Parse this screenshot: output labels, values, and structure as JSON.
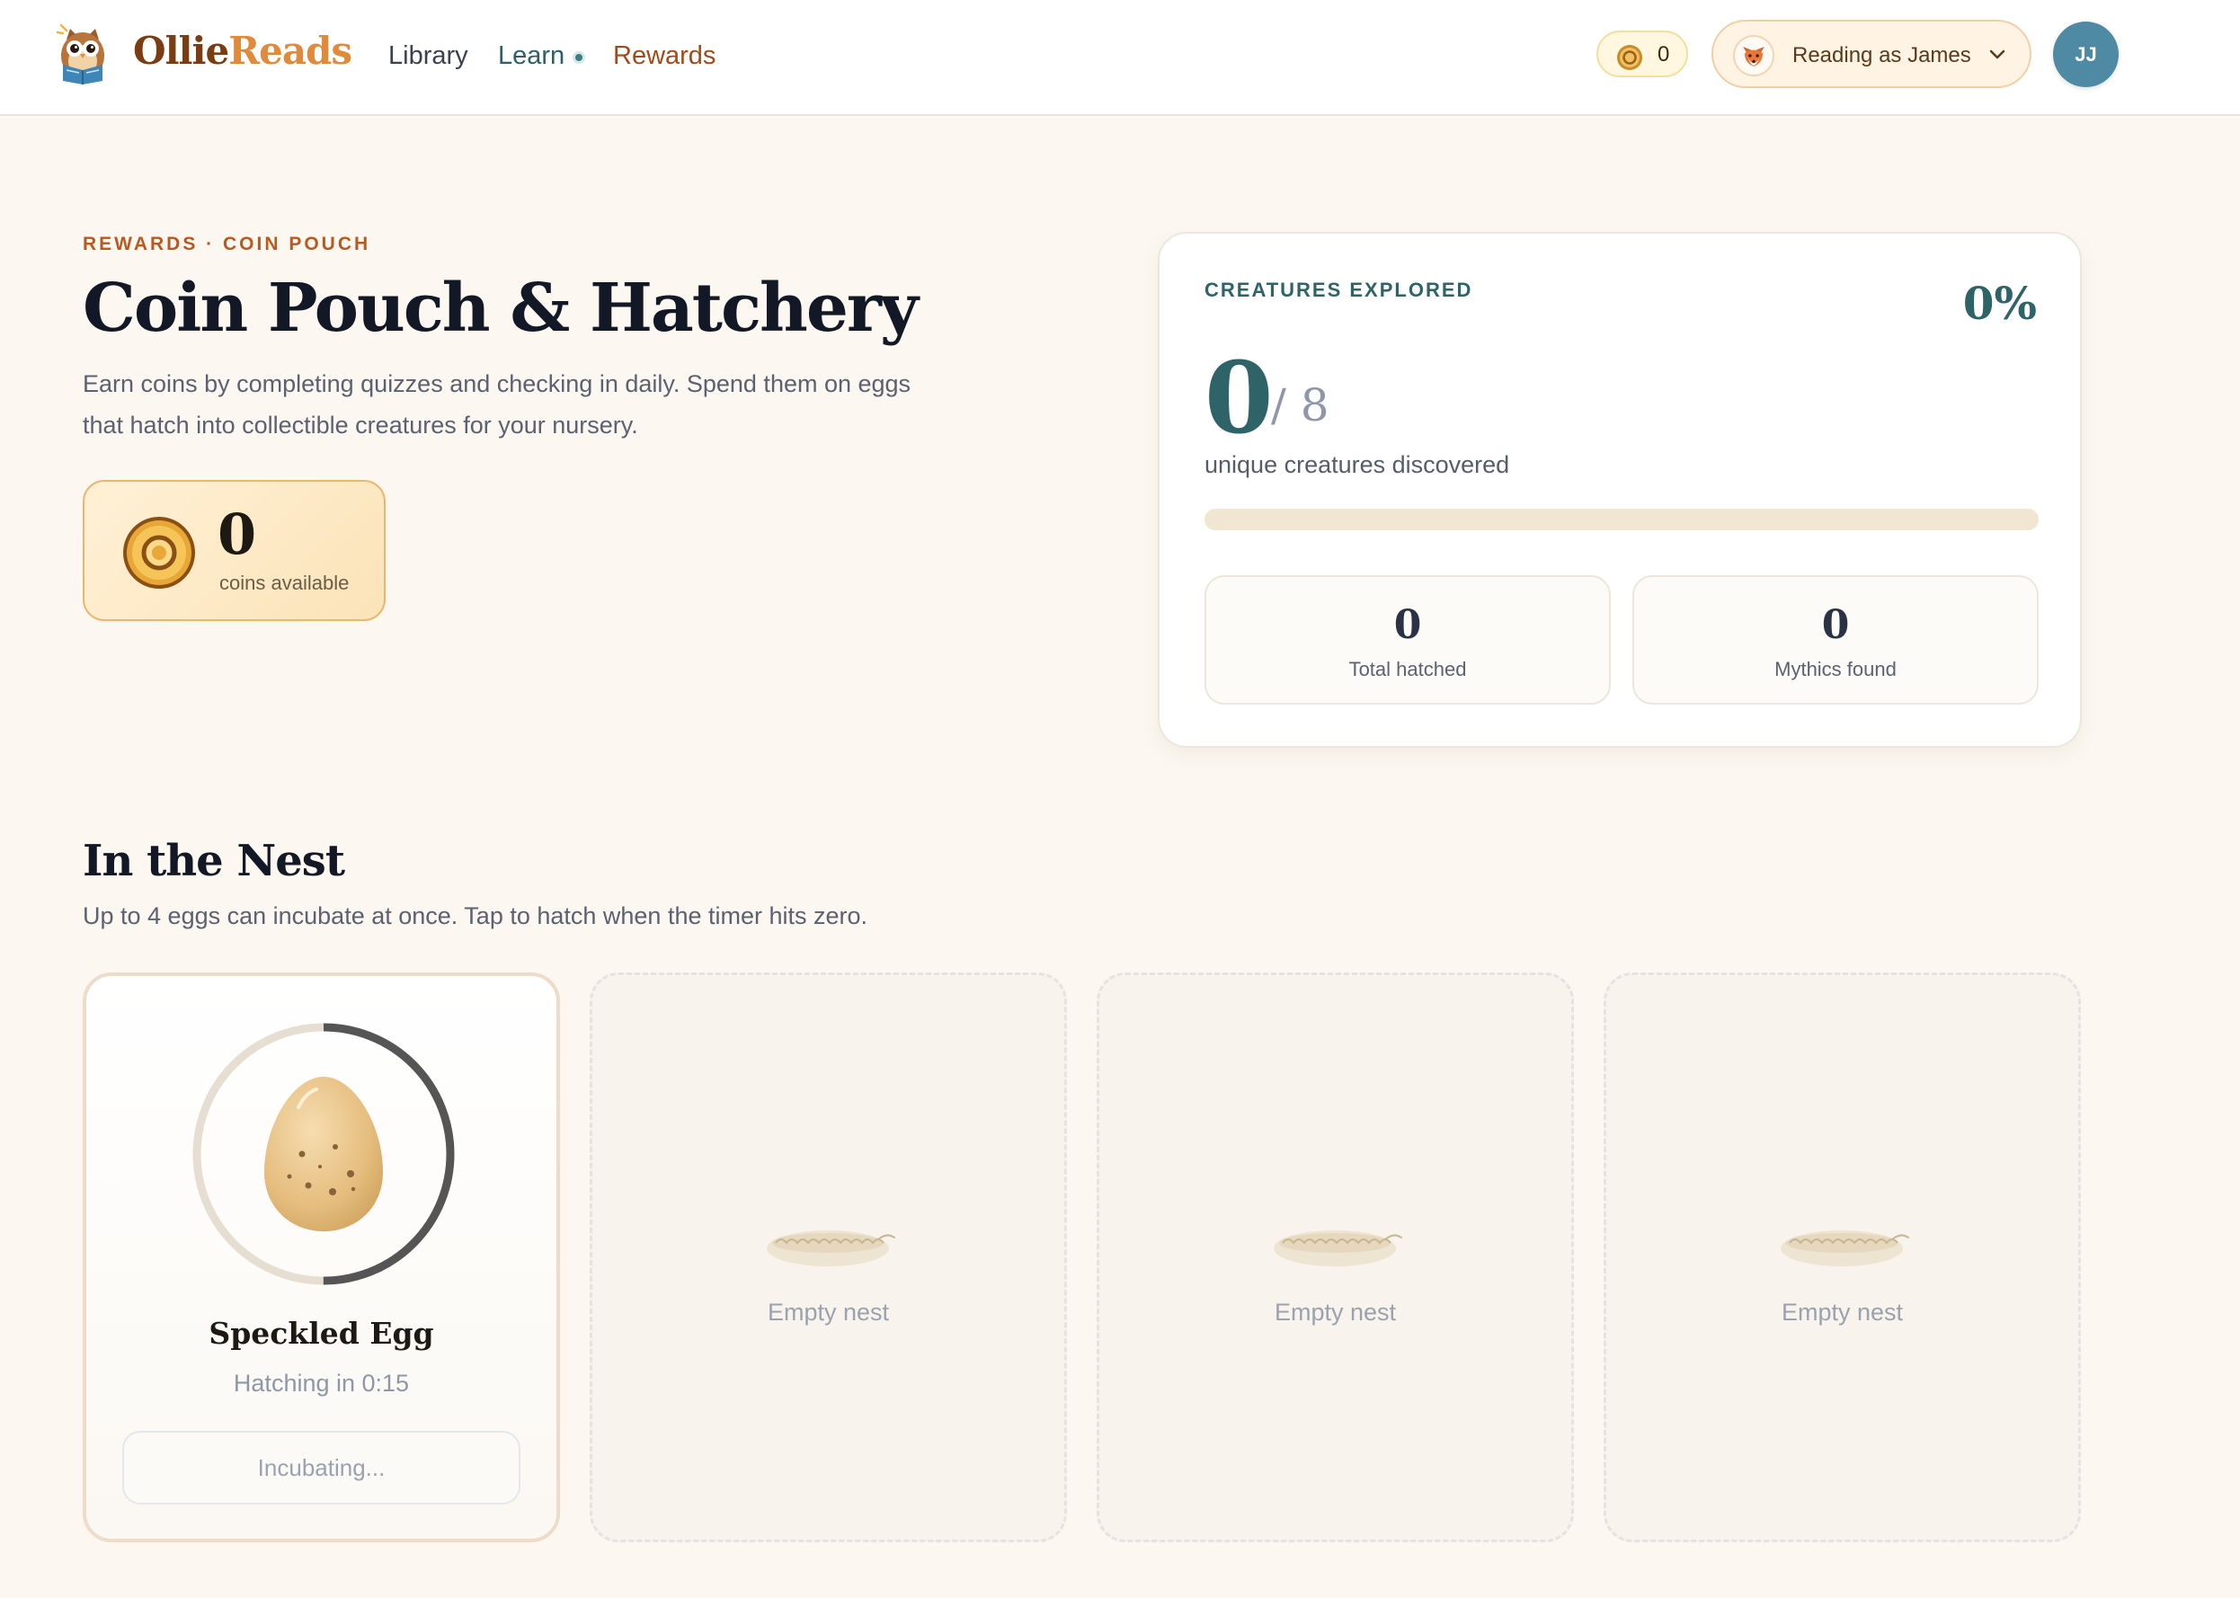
{
  "header": {
    "brand_part1": "Ollie",
    "brand_part2": "Reads",
    "nav": [
      {
        "label": "Library",
        "active": false
      },
      {
        "label": "Learn",
        "active": false,
        "has_dot": true
      },
      {
        "label": "Rewards",
        "active": true
      }
    ],
    "coin_balance": "0",
    "reader_label": "Reading as James",
    "avatar_initials": "JJ"
  },
  "hero": {
    "eyebrow": "REWARDS · COIN POUCH",
    "title": "Coin Pouch & Hatchery",
    "description": "Earn coins by completing quizzes and checking in daily. Spend them on eggs that hatch into collectible creatures for your nursery.",
    "coins_value": "0",
    "coins_caption": "coins available"
  },
  "creatures": {
    "label": "CREATURES EXPLORED",
    "percent": "0%",
    "discovered": "0",
    "total": "/ 8",
    "subtitle": "unique creatures discovered",
    "progress_fraction": 0,
    "stats": [
      {
        "value": "0",
        "label": "Total hatched"
      },
      {
        "value": "0",
        "label": "Mythics found"
      }
    ]
  },
  "nest": {
    "title": "In the Nest",
    "description": "Up to 4 eggs can incubate at once. Tap to hatch when the timer hits zero.",
    "slots": [
      {
        "type": "egg",
        "name": "Speckled Egg",
        "timer": "Hatching in 0:15",
        "button": "Incubating...",
        "progress_fraction": 0.5
      },
      {
        "type": "empty",
        "label": "Empty nest"
      },
      {
        "type": "empty",
        "label": "Empty nest"
      },
      {
        "type": "empty",
        "label": "Empty nest"
      }
    ]
  },
  "colors": {
    "accent_teal": "#2e6468",
    "accent_orange": "#b85a20",
    "background": "#fcf8f1",
    "ring_progress": "#555555",
    "ring_track": "#e6ded0"
  }
}
